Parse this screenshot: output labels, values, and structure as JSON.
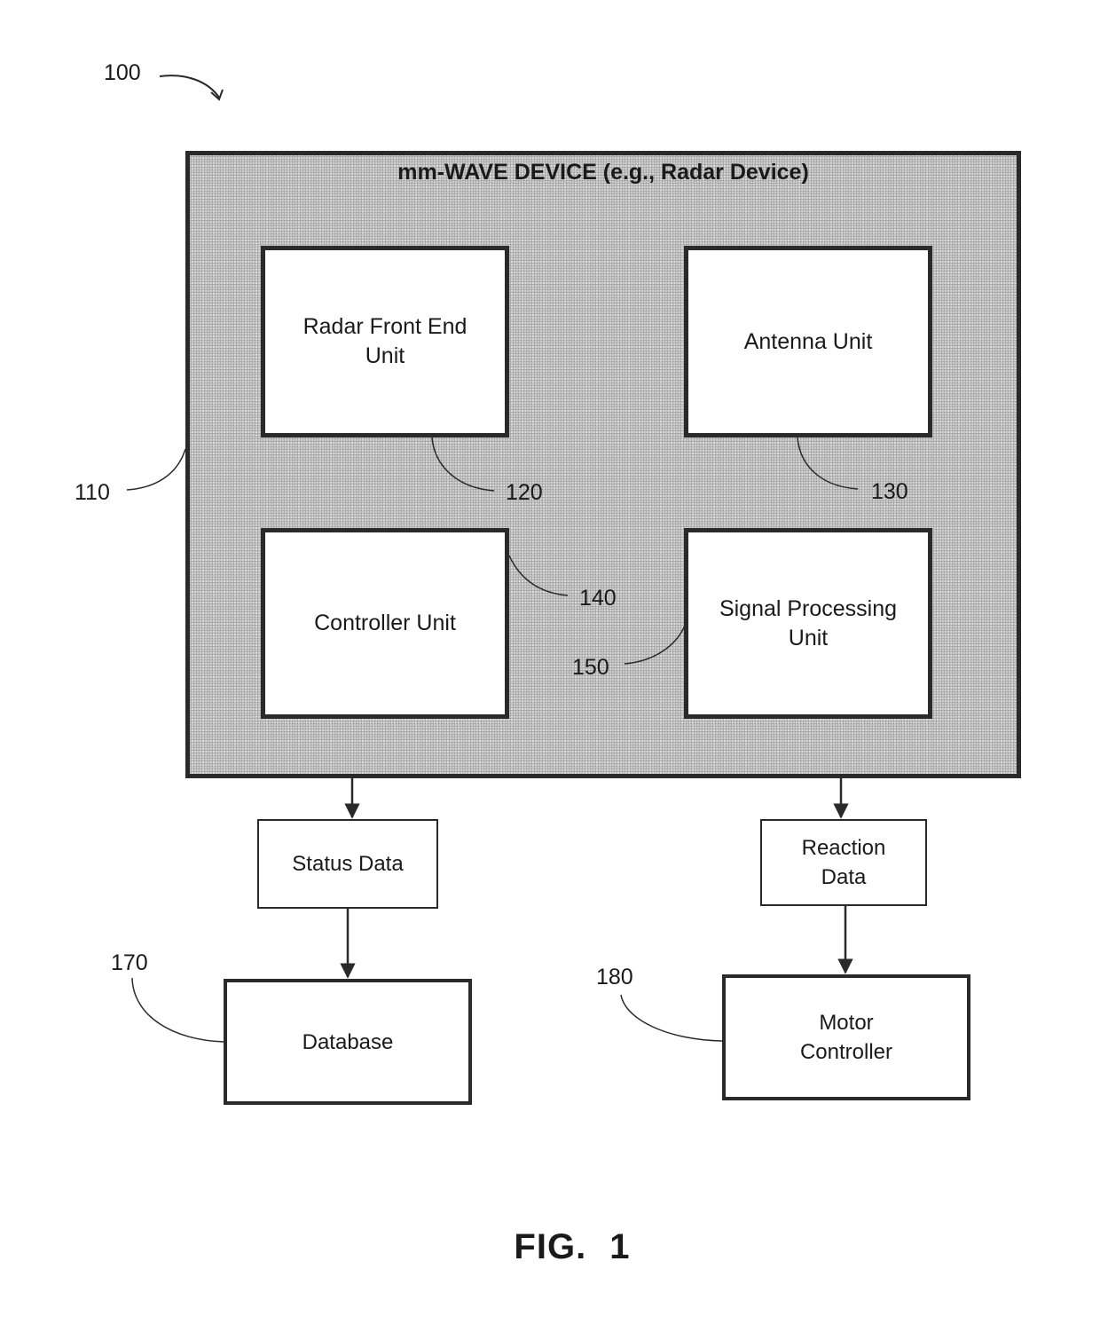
{
  "figure": {
    "caption": "FIG. 1",
    "system_ref": "100"
  },
  "device": {
    "title": "mm-WAVE DEVICE (e.g., Radar Device)",
    "ref": "110",
    "units": [
      {
        "id": "radar-front-end",
        "label": "Radar Front End\nUnit",
        "ref": "120"
      },
      {
        "id": "antenna",
        "label": "Antenna Unit",
        "ref": "130"
      },
      {
        "id": "controller",
        "label": "Controller Unit",
        "ref": "140"
      },
      {
        "id": "signal-processing",
        "label": "Signal Processing\nUnit",
        "ref": "150"
      }
    ]
  },
  "outputs": {
    "status_data": "Status Data",
    "reaction_data": "Reaction\nData"
  },
  "destinations": {
    "database": {
      "label": "Database",
      "ref": "170"
    },
    "motor_controller": {
      "label": "Motor\nController",
      "ref": "180"
    }
  },
  "flows": [
    {
      "from": "mm-WAVE DEVICE",
      "to": "Status Data"
    },
    {
      "from": "Status Data",
      "to": "Database"
    },
    {
      "from": "mm-WAVE DEVICE",
      "to": "Reaction Data"
    },
    {
      "from": "Reaction Data",
      "to": "Motor Controller"
    }
  ]
}
